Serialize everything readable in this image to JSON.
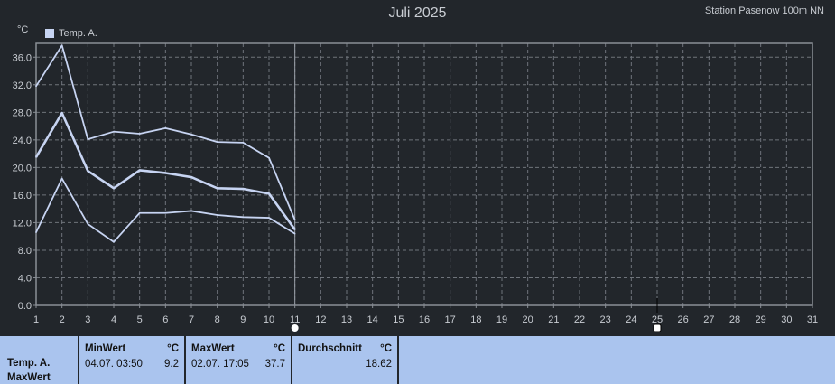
{
  "header": {
    "title": "Juli 2025",
    "station": "Station Pasenow 100m NN",
    "unit": "°C"
  },
  "chart_data": {
    "type": "line",
    "legend": "Temp. A.",
    "x": [
      1,
      2,
      3,
      4,
      5,
      6,
      7,
      8,
      9,
      10,
      11
    ],
    "series": [
      {
        "name": "Temp. A.",
        "label": "max",
        "values": [
          31.8,
          37.7,
          24.1,
          25.2,
          24.9,
          25.7,
          24.8,
          23.7,
          23.6,
          21.4,
          12.4
        ]
      },
      {
        "name": "Temp. A.",
        "label": "avg",
        "values": [
          21.5,
          27.9,
          19.5,
          17.0,
          19.6,
          19.2,
          18.6,
          17.0,
          16.9,
          16.2,
          11.0
        ]
      },
      {
        "name": "Temp. A.",
        "label": "min",
        "values": [
          10.6,
          18.4,
          11.8,
          9.2,
          13.4,
          13.4,
          13.7,
          13.1,
          12.8,
          12.7,
          10.4
        ]
      }
    ],
    "xlim": [
      1,
      31
    ],
    "ylim": [
      0,
      38
    ],
    "y_ticks": [
      "0.0",
      "4.0",
      "8.0",
      "12.0",
      "16.0",
      "20.0",
      "24.0",
      "28.0",
      "32.0",
      "36.0"
    ],
    "x_ticks": [
      "1",
      "2",
      "3",
      "4",
      "5",
      "6",
      "7",
      "8",
      "9",
      "10",
      "11",
      "12",
      "13",
      "14",
      "15",
      "16",
      "17",
      "18",
      "19",
      "20",
      "21",
      "22",
      "23",
      "24",
      "25",
      "26",
      "27",
      "28",
      "29",
      "30",
      "31"
    ],
    "current_day": 11,
    "grid": true,
    "line_color": "#c7d4f2"
  },
  "stats": {
    "series_label_1": "Temp. A.",
    "series_label_2": "MaxWert",
    "min": {
      "header": "MinWert",
      "unit": "°C",
      "when": "04.07.  03:50",
      "value": "9.2"
    },
    "max": {
      "header": "MaxWert",
      "unit": "°C",
      "when": "02.07.  17:05",
      "value": "37.7"
    },
    "avg": {
      "header": "Durchschnitt",
      "unit": "°C",
      "value": "18.62"
    }
  }
}
